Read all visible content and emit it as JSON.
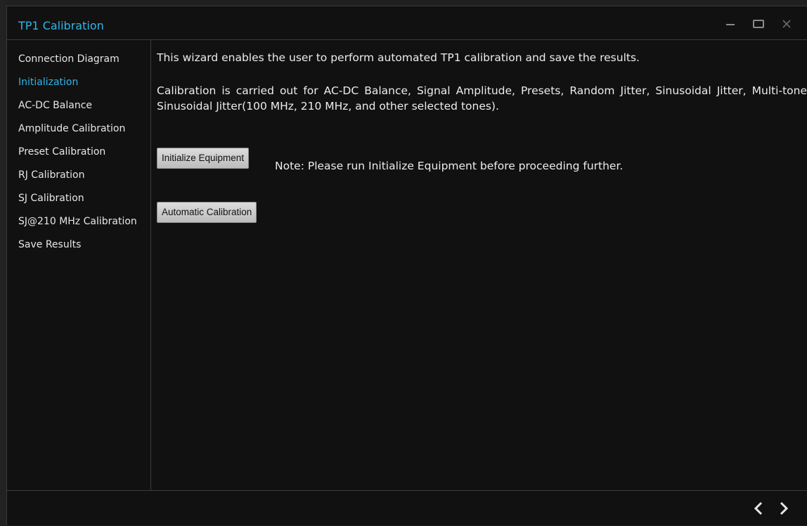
{
  "window": {
    "title": "TP1 Calibration",
    "accent_color": "#2eb6e8"
  },
  "sidebar": {
    "active_index": 1,
    "items": [
      {
        "label": "Connection Diagram"
      },
      {
        "label": "Initialization"
      },
      {
        "label": "AC-DC Balance"
      },
      {
        "label": "Amplitude Calibration"
      },
      {
        "label": "Preset Calibration"
      },
      {
        "label": "RJ Calibration"
      },
      {
        "label": "SJ Calibration"
      },
      {
        "label": "SJ@210 MHz Calibration"
      },
      {
        "label": "Save Results"
      }
    ]
  },
  "content": {
    "intro": "This wizard enables the user to perform automated TP1 calibration and save the results.",
    "description": "Calibration is carried out for AC-DC Balance, Signal Amplitude, Presets, Random Jitter, Sinusoidal Jitter, Multi-tone Sinusoidal Jitter(100 MHz, 210 MHz, and other selected tones).",
    "init_button_label": "Initialize Equipment",
    "note": "Note: Please run Initialize Equipment before proceeding further.",
    "auto_button_label": "Automatic Calibration"
  },
  "icons": {
    "minimize": "minimize-icon",
    "maximize": "maximize-icon",
    "close": "close-icon",
    "back": "chevron-left-icon",
    "next": "chevron-right-icon"
  }
}
